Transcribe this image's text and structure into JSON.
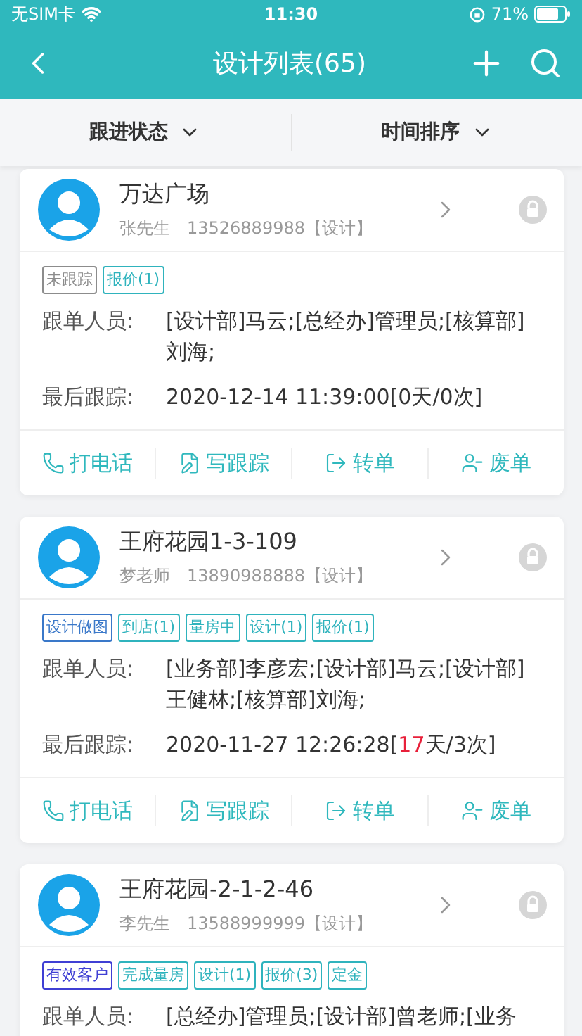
{
  "status_bar": {
    "carrier": "无SIM卡",
    "time": "11:30",
    "battery": "71%"
  },
  "nav": {
    "title": "设计列表(65)"
  },
  "filters": [
    {
      "label": "跟进状态"
    },
    {
      "label": "时间排序"
    }
  ],
  "cards": [
    {
      "title": "万达广场",
      "contact": "张先生",
      "phone": "13526889988【设计】",
      "tags": [
        {
          "label": "未跟踪",
          "color": "#8c8c8c"
        },
        {
          "label": "报价(1)",
          "color": "#2fb3bd"
        }
      ],
      "rows": [
        {
          "label": "跟单人员:",
          "parts": [
            {
              "text": "[设计部]马云;[总经办]管理员;[核算部]刘海;",
              "highlight": false
            }
          ]
        },
        {
          "label": "最后跟踪:",
          "parts": [
            {
              "text": "2020-12-14 11:39:00[0天/0次]",
              "highlight": false
            }
          ]
        }
      ],
      "actions": [
        "打电话",
        "写跟踪",
        "转单",
        "废单"
      ]
    },
    {
      "title": "王府花园1-3-109",
      "contact": "梦老师",
      "phone": "13890988888【设计】",
      "tags": [
        {
          "label": "设计做图",
          "color": "#3a78c9"
        },
        {
          "label": "到店(1)",
          "color": "#2fb3bd"
        },
        {
          "label": "量房中",
          "color": "#2fb3bd"
        },
        {
          "label": "设计(1)",
          "color": "#2fb3bd"
        },
        {
          "label": "报价(1)",
          "color": "#2fb3bd"
        }
      ],
      "rows": [
        {
          "label": "跟单人员:",
          "parts": [
            {
              "text": "[业务部]李彦宏;[设计部]马云;[设计部]王健林;[核算部]刘海;",
              "highlight": false
            }
          ]
        },
        {
          "label": "最后跟踪:",
          "parts": [
            {
              "text": "2020-11-27 12:26:28[",
              "highlight": false
            },
            {
              "text": "17",
              "highlight": true
            },
            {
              "text": "天/3次]",
              "highlight": false
            }
          ]
        }
      ],
      "actions": [
        "打电话",
        "写跟踪",
        "转单",
        "废单"
      ]
    },
    {
      "title": "王府花园-2-1-2-46",
      "contact": "李先生",
      "phone": "13588999999【设计】",
      "tags": [
        {
          "label": "有效客户",
          "color": "#3f3fd4"
        },
        {
          "label": "完成量房",
          "color": "#2fb3bd"
        },
        {
          "label": "设计(1)",
          "color": "#2fb3bd"
        },
        {
          "label": "报价(3)",
          "color": "#2fb3bd"
        },
        {
          "label": "定金",
          "color": "#2fb3bd"
        }
      ],
      "rows": [
        {
          "label": "跟单人员:",
          "parts": [
            {
              "text": "[总经办]管理员;[设计部]曾老师;[业务",
              "highlight": false
            }
          ]
        }
      ]
    }
  ]
}
